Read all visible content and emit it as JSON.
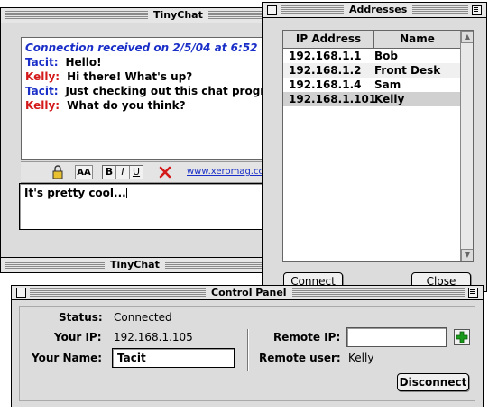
{
  "tinychat": {
    "title": "TinyChat",
    "notice": "Connection received on 2/5/04 at 6:52 PM",
    "messages": [
      {
        "who": "Tacit:",
        "text": "Hello!",
        "color": "#1a2fc8"
      },
      {
        "who": "Kelly:",
        "text": "Hi there! What's up?",
        "color": "#d41a1a"
      },
      {
        "who": "Tacit:",
        "text": "Just checking out this chat program",
        "color": "#1a2fc8"
      },
      {
        "who": "Kelly:",
        "text": "What do you think?",
        "color": "#d41a1a"
      }
    ],
    "toolbar": {
      "aa_label": "AA",
      "bold_label": "B",
      "italic_label": "I",
      "underline_label": "U",
      "link_text": "www.xeromag.com",
      "icons": [
        "lock-icon",
        "font-size-icon",
        "delete-x-icon"
      ]
    },
    "compose_value": "It's pretty cool..."
  },
  "addresses": {
    "title": "Addresses",
    "columns": [
      "IP Address",
      "Name"
    ],
    "rows": [
      {
        "ip": "192.168.1.1",
        "name": "Bob"
      },
      {
        "ip": "192.168.1.2",
        "name": "Front Desk"
      },
      {
        "ip": "192.168.1.4",
        "name": "Sam"
      },
      {
        "ip": "192.168.1.101",
        "name": "Kelly",
        "selected": true
      }
    ],
    "connect_label": "Connect",
    "close_label": "Close"
  },
  "control": {
    "title": "Control Panel",
    "status_label": "Status:",
    "status_value": "Connected",
    "your_ip_label": "Your IP:",
    "your_ip_value": "192.168.1.105",
    "your_name_label": "Your Name:",
    "your_name_value": "Tacit",
    "remote_ip_label": "Remote IP:",
    "remote_ip_value": "",
    "remote_user_label": "Remote user:",
    "remote_user_value": "Kelly",
    "disconnect_label": "Disconnect",
    "add_icon": "plus-icon"
  },
  "colors": {
    "tacit": "#1a2fc8",
    "kelly": "#d41a1a",
    "notice": "#1a2fc8",
    "link": "#1a2fc8",
    "add_button": "#1a9a1a",
    "selected_row": "#d0d0d0"
  }
}
